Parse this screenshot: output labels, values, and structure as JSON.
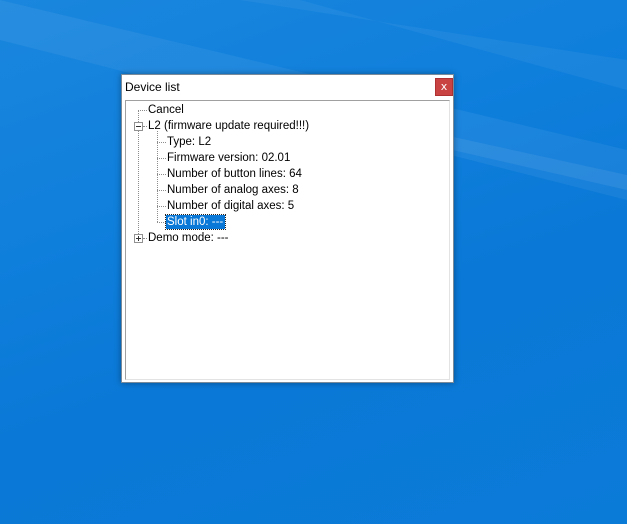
{
  "window": {
    "title": "Device list",
    "close_label": "x"
  },
  "tree": {
    "items": [
      {
        "label": "Cancel",
        "level": 0
      },
      {
        "label": "L2 (firmware update required!!!)",
        "level": 0,
        "expanded": true
      },
      {
        "label": "Type: L2",
        "level": 1
      },
      {
        "label": "Firmware version: 02.01",
        "level": 1
      },
      {
        "label": "Number of button lines: 64",
        "level": 1
      },
      {
        "label": "Number of analog axes: 8",
        "level": 1
      },
      {
        "label": "Number of digital axes: 5",
        "level": 1
      },
      {
        "label": "Slot in0: ---",
        "level": 1,
        "selected": true
      },
      {
        "label": "Demo mode:  ---",
        "level": 0,
        "expanded": false
      }
    ]
  },
  "colors": {
    "desktop": "#0f7fdc",
    "selection": "#0a78d7",
    "close_button": "#c94343"
  }
}
